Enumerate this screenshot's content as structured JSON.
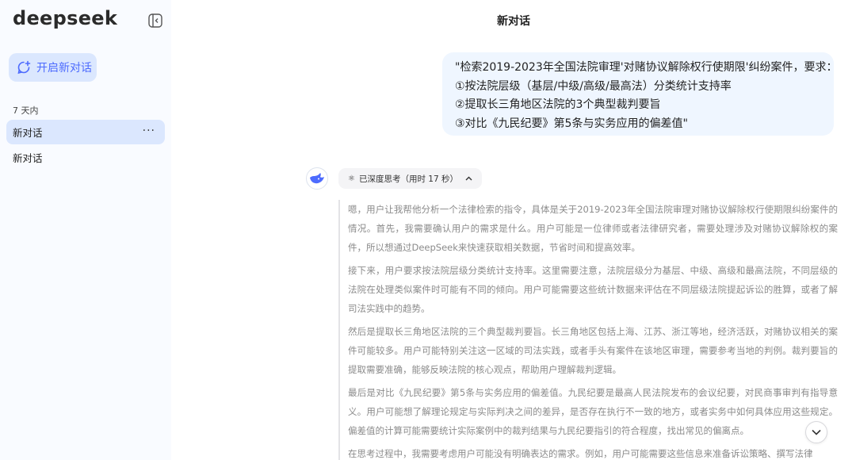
{
  "sidebar": {
    "logo": "deepseek",
    "new_chat_label": "开启新对话",
    "section_label": "7 天内",
    "items": [
      {
        "label": "新对话",
        "more": "···"
      },
      {
        "label": "新对话"
      }
    ]
  },
  "header": {
    "title": "新对话"
  },
  "user_message": {
    "lines": [
      "\"检索2019-2023年全国法院审理'对赌协议解除权行使期限'纠纷案件，要求：",
      "①按法院层级（基层/中级/高级/最高法）分类统计支持率",
      "②提取长三角地区法院的3个典型裁判要旨",
      "③对比《九民纪要》第5条与实务应用的偏差值\""
    ]
  },
  "assistant": {
    "think_chip_label": "已深度思考（用时 17 秒）",
    "paragraphs": [
      "嗯，用户让我帮他分析一个法律检索的指令，具体是关于2019-2023年全国法院审理对赌协议解除权行使期限纠纷案件的情况。首先，我需要确认用户的需求是什么。用户可能是一位律师或者法律研究者，需要处理涉及对赌协议解除权的案件，所以想通过DeepSeek来快速获取相关数据，节省时间和提高效率。",
      "接下来，用户要求按法院层级分类统计支持率。这里需要注意，法院层级分为基层、中级、高级和最高法院，不同层级的法院在处理类似案件时可能有不同的倾向。用户可能需要这些统计数据来评估在不同层级法院提起诉讼的胜算，或者了解司法实践中的趋势。",
      "然后是提取长三角地区法院的三个典型裁判要旨。长三角地区包括上海、江苏、浙江等地，经济活跃，对赌协议相关的案件可能较多。用户可能特别关注这一区域的司法实践，或者手头有案件在该地区审理，需要参考当地的判例。裁判要旨的提取需要准确，能够反映法院的核心观点，帮助用户理解裁判逻辑。",
      "最后是对比《九民纪要》第5条与实务应用的偏差值。九民纪要是最高人民法院发布的会议纪要，对民商事审判有指导意义。用户可能想了解理论规定与实际判决之间的差异，是否存在执行不一致的地方，或者实务中如何具体应用这些规定。偏差值的计算可能需要统计实际案例中的裁判结果与九民纪要指引的符合程度，找出常见的偏离点。",
      "在思考过程中，我需要考虑用户可能没有明确表达的需求。例如，用户可能需要这些信息来准备诉讼策略、撰写法律"
    ]
  },
  "colors": {
    "accent": "#4d6bfe",
    "sidebar_bg": "#f9fbff",
    "active_bg": "#dbe7fe",
    "bubble_bg": "#eff6ff"
  }
}
